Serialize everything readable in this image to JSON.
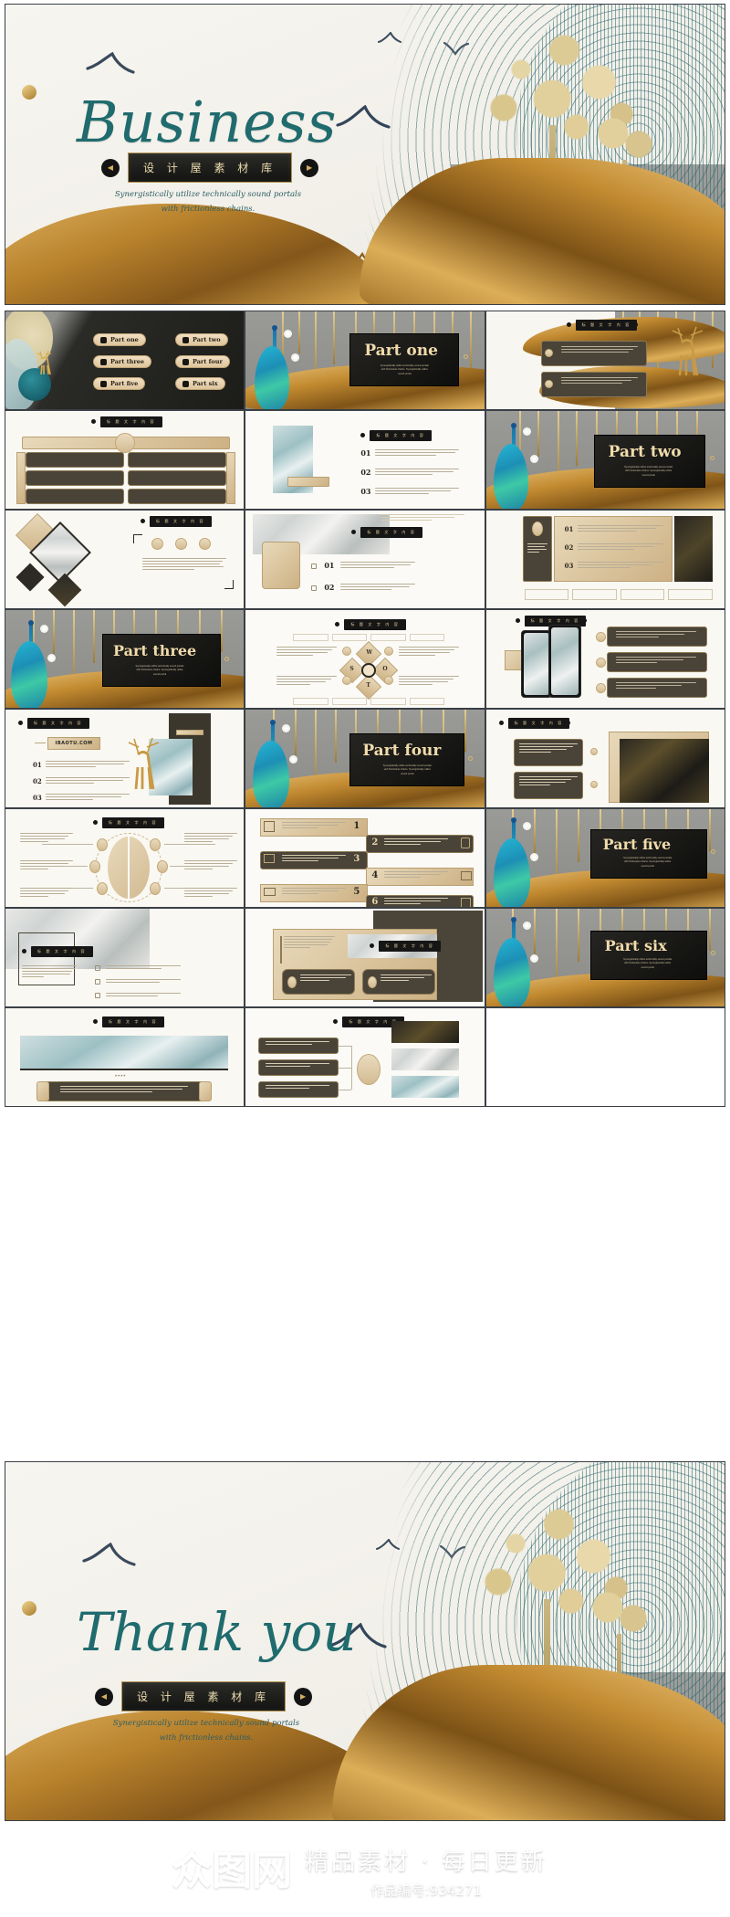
{
  "cover": {
    "title": "Business",
    "brand_plate": "设 计 屋 素 材 库",
    "subtitle_line1": "Synergistically utilize technically sound portals",
    "subtitle_line2": "with frictionless chains.",
    "prev_arrow": "◀",
    "next_arrow": "▶",
    "accent_teal": "#1f6b6e",
    "accent_gold": "#c9a council"
  },
  "thanks": {
    "title": "Thank you",
    "brand_plate": "设 计 屋 素 材 库",
    "subtitle_line1": "Synergistically utilize technically sound portals",
    "subtitle_line2": "with frictionless chains.",
    "prev_arrow": "◀",
    "next_arrow": "▶"
  },
  "menu_slide": {
    "items": [
      {
        "label": "Part one"
      },
      {
        "label": "Part two"
      },
      {
        "label": "Part three"
      },
      {
        "label": "Part four"
      },
      {
        "label": "Part five"
      },
      {
        "label": "Part six"
      }
    ]
  },
  "section_slides": [
    {
      "label": "Part one",
      "sub1": "Synergistically utilize technically sound portals",
      "sub2": "with frictionless chains. Synergistically utilize",
      "sub3": "sound portal"
    },
    {
      "label": "Part two",
      "sub1": "Synergistically utilize technically sound portals",
      "sub2": "with frictionless chains. Synergistically utilize",
      "sub3": "sound portal"
    },
    {
      "label": "Part three",
      "sub1": "Synergistically utilize technically sound portals",
      "sub2": "with frictionless chains. Synergistically utilize",
      "sub3": "sound portal"
    },
    {
      "label": "Part four",
      "sub1": "Synergistically utilize technically sound portals",
      "sub2": "with frictionless chains. Synergistically utilize",
      "sub3": "sound portal"
    },
    {
      "label": "Part five",
      "sub1": "Synergistically utilize technically sound portals",
      "sub2": "with frictionless chains. Synergistically utilize",
      "sub3": "sound portal"
    },
    {
      "label": "Part six",
      "sub1": "Synergistically utilize technically sound portals",
      "sub2": "with frictionless chains. Synergistically utilize",
      "sub3": "sound portal"
    }
  ],
  "slide_title_plate": "标 题 文 字 内 容",
  "website_label": "IBAOTU.COM",
  "numbers": {
    "n01": "01",
    "n02": "02",
    "n03": "03",
    "n1": "1",
    "n2": "2",
    "n3": "3",
    "n4": "4",
    "n5": "5",
    "n6": "6"
  },
  "swot": {
    "s": "S",
    "w": "W",
    "o": "O",
    "t": "T"
  },
  "watermark": {
    "logo": "众图网",
    "slogan": "精品素材 · 每日更新",
    "code": "作品编号:934271"
  }
}
